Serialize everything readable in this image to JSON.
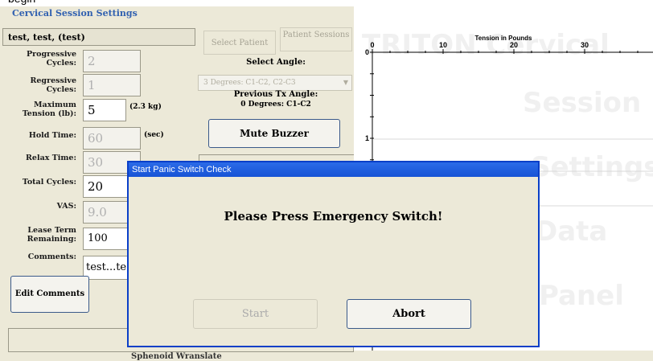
{
  "background": {
    "top_strip_text": "begin"
  },
  "panel": {
    "title": "Cervical Session Settings",
    "patient_name": "test, test, (test)",
    "select_patient_label": "Select Patient",
    "patient_sessions_label": "Patient Sessions",
    "select_angle_label": "Select Angle:",
    "angle_value": "3 Degrees: C1-C2, C2-C3",
    "prev_tx_label": "Previous Tx Angle:",
    "prev_tx_value": "0 Degrees: C1-C2",
    "mute_label": "Mute Buzzer",
    "progressive_label": "Progressive Cycles:",
    "progressive_value": "2",
    "regressive_label": "Regressive Cycles:",
    "regressive_value": "1",
    "max_tension_label": "Maximum Tension (lb):",
    "max_tension_value": "5",
    "max_tension_unit": "(2.3 kg)",
    "hold_label": "Hold Time:",
    "hold_value": "60",
    "hold_unit": "(sec)",
    "relax_label": "Relax Time:",
    "relax_value": "30",
    "total_label": "Total Cycles:",
    "total_value": "20",
    "vas_label": "VAS:",
    "vas_value": "9.0",
    "lease_label": "Lease Term Remaining:",
    "lease_value": "100",
    "comments_label": "Comments:",
    "comments_value": "test...te",
    "edit_comments_label": "Edit Comments",
    "bottom_text": "Sphenoid  Wranslate"
  },
  "chart": {
    "title": "Tension in Pounds",
    "x_ticks": [
      "0",
      "10",
      "20",
      "30"
    ],
    "y_ticks": [
      "0",
      "1"
    ],
    "watermark": [
      "TRITON Cervical",
      "Session",
      "Settings",
      "Data",
      "Panel"
    ]
  },
  "dialog": {
    "title": "Start Panic Switch Check",
    "message": "Please Press Emergency Switch!",
    "start_label": "Start",
    "abort_label": "Abort"
  },
  "colors": {
    "dialog_title": "#1d5fe0",
    "panel_bg": "#ece9d8",
    "accent_text": "#3060b0"
  }
}
